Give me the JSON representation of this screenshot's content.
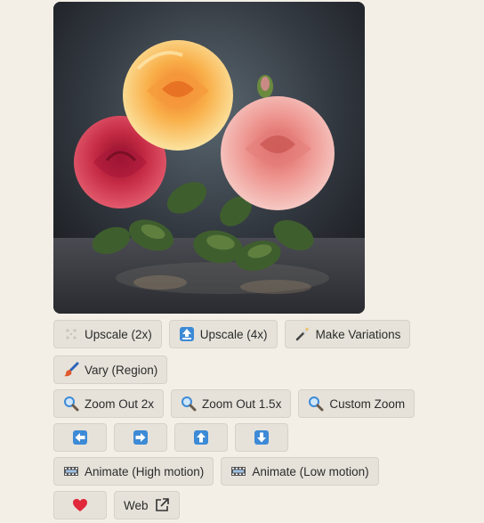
{
  "image": {
    "alt": ""
  },
  "row1": [
    {
      "label": "Upscale (2x)",
      "icon": "sparkle-icon"
    },
    {
      "label": "Upscale (4x)",
      "icon": "up-arrow-box-icon"
    },
    {
      "label": "Make Variations",
      "icon": "magic-wand-icon"
    }
  ],
  "row2": [
    {
      "label": "Vary (Region)",
      "icon": "paintbrush-icon"
    }
  ],
  "row3": [
    {
      "label": "Zoom Out 2x",
      "icon": "magnifier-icon"
    },
    {
      "label": "Zoom Out 1.5x",
      "icon": "magnifier-icon"
    },
    {
      "label": "Custom Zoom",
      "icon": "magnifier-icon"
    }
  ],
  "pan": [
    {
      "icon": "left-arrow-icon"
    },
    {
      "icon": "right-arrow-icon"
    },
    {
      "icon": "up-arrow-icon"
    },
    {
      "icon": "down-arrow-icon"
    }
  ],
  "row5": [
    {
      "label": "Animate (High motion)",
      "icon": "film-frames-icon"
    },
    {
      "label": "Animate (Low motion)",
      "icon": "film-frames-icon"
    }
  ],
  "row6": {
    "favorite_icon": "red-heart-icon",
    "web_label": "Web",
    "web_icon": "external-link-icon"
  },
  "colors": {
    "background": "#f3efe7",
    "button": "#e6e2da",
    "blue_icon": "#3d8ad6",
    "heart": "#e0283a"
  }
}
